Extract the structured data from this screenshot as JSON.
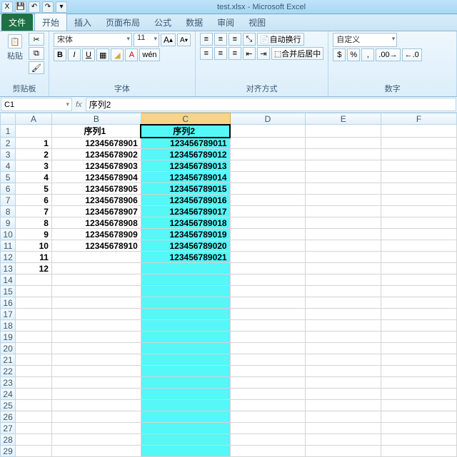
{
  "title": "test.xlsx - Microsoft Excel",
  "tabs": {
    "file": "文件",
    "home": "开始",
    "insert": "插入",
    "layout": "页面布局",
    "formulas": "公式",
    "data": "数据",
    "review": "审阅",
    "view": "视图"
  },
  "ribbon": {
    "clipboard": {
      "paste": "粘贴",
      "label": "剪贴板"
    },
    "font": {
      "name": "宋体",
      "size": "11",
      "increase": "A",
      "decrease": "A",
      "label": "字体"
    },
    "align": {
      "wrap": "自动换行",
      "merge": "合并后居中",
      "label": "对齐方式"
    },
    "number": {
      "format": "自定义",
      "percent": "%",
      "comma": ",",
      "label": "数字"
    }
  },
  "namebox": "C1",
  "formula": "序列2",
  "columns": [
    "A",
    "B",
    "C",
    "D",
    "E",
    "F"
  ],
  "rows": [
    "1",
    "2",
    "3",
    "4",
    "5",
    "6",
    "7",
    "8",
    "9",
    "10",
    "11",
    "12",
    "13",
    "14",
    "15",
    "16",
    "17",
    "18",
    "19",
    "20",
    "21",
    "22",
    "23",
    "24",
    "25",
    "26",
    "27",
    "28",
    "29"
  ],
  "cells": {
    "B1": "序列1",
    "C1": "序列2",
    "A2": "1",
    "B2": "12345678901",
    "C2": "123456789011",
    "A3": "2",
    "B3": "12345678902",
    "C3": "123456789012",
    "A4": "3",
    "B4": "12345678903",
    "C4": "123456789013",
    "A5": "4",
    "B5": "12345678904",
    "C5": "123456789014",
    "A6": "5",
    "B6": "12345678905",
    "C6": "123456789015",
    "A7": "6",
    "B7": "12345678906",
    "C7": "123456789016",
    "A8": "7",
    "B8": "12345678907",
    "C8": "123456789017",
    "A9": "8",
    "B9": "12345678908",
    "C9": "123456789018",
    "A10": "9",
    "B10": "12345678909",
    "C10": "123456789019",
    "A11": "10",
    "B11": "12345678910",
    "C11": "123456789020",
    "A12": "11",
    "C12": "123456789021",
    "A13": "12"
  },
  "highlight_col": "C",
  "selected_cell": "C1"
}
